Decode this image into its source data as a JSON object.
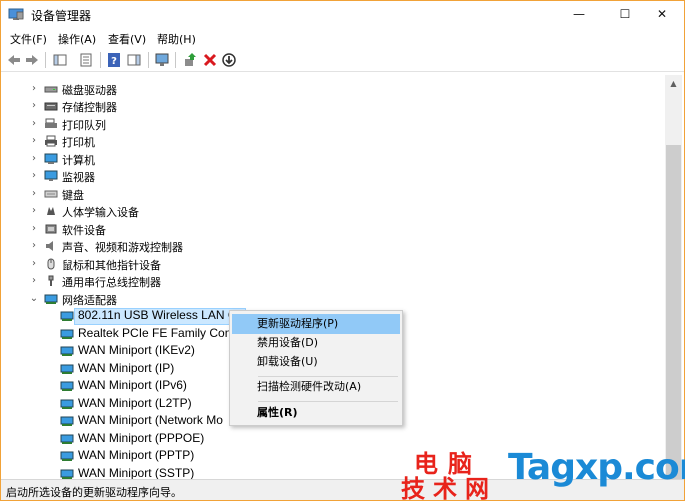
{
  "window": {
    "title": "设备管理器",
    "min_glyph": "—",
    "max_glyph": "☐",
    "close_glyph": "✕"
  },
  "menu": [
    "文件(F)",
    "操作(A)",
    "查看(V)",
    "帮助(H)"
  ],
  "categories": [
    {
      "label": "磁盘驱动器",
      "icon": "disk-icon",
      "expander": "›"
    },
    {
      "label": "存储控制器",
      "icon": "storage-icon",
      "expander": "›"
    },
    {
      "label": "打印队列",
      "icon": "print-queue-icon",
      "expander": "›"
    },
    {
      "label": "打印机",
      "icon": "printer-icon",
      "expander": "›"
    },
    {
      "label": "计算机",
      "icon": "computer-icon",
      "expander": "›"
    },
    {
      "label": "监视器",
      "icon": "monitor-icon",
      "expander": "›"
    },
    {
      "label": "键盘",
      "icon": "keyboard-icon",
      "expander": "›"
    },
    {
      "label": "人体学输入设备",
      "icon": "hid-icon",
      "expander": "›"
    },
    {
      "label": "软件设备",
      "icon": "software-device-icon",
      "expander": "›"
    },
    {
      "label": "声音、视频和游戏控制器",
      "icon": "sound-icon",
      "expander": "›"
    },
    {
      "label": "鼠标和其他指针设备",
      "icon": "mouse-icon",
      "expander": "›"
    },
    {
      "label": "通用串行总线控制器",
      "icon": "usb-icon",
      "expander": "›"
    },
    {
      "label": "网络适配器",
      "icon": "network-adapter-icon",
      "expander": "⌄"
    }
  ],
  "devices": [
    "802.11n USB Wireless LAN Ca",
    "Realtek PCIe FE Family Contro",
    "WAN Miniport (IKEv2)",
    "WAN Miniport (IP)",
    "WAN Miniport (IPv6)",
    "WAN Miniport (L2TP)",
    "WAN Miniport (Network Mo",
    "WAN Miniport (PPPOE)",
    "WAN Miniport (PPTP)",
    "WAN Miniport (SSTP)"
  ],
  "context_menu": {
    "update_driver": "更新驱动程序(P)",
    "disable_device": "禁用设备(D)",
    "uninstall_device": "卸载设备(U)",
    "scan_hardware": "扫描检测硬件改动(A)",
    "properties": "属性(R)"
  },
  "status_text": "启动所选设备的更新驱动程序向导。",
  "watermark": {
    "line1": "电脑",
    "line2": "技术网",
    "site": "Tagxp.com"
  },
  "colors": {
    "selection": "#cce8ff",
    "menu_highlight": "#91c9f7",
    "watermark_red": "#e8231b",
    "watermark_blue": "#1b8ad6",
    "window_border": "#f1a238"
  }
}
